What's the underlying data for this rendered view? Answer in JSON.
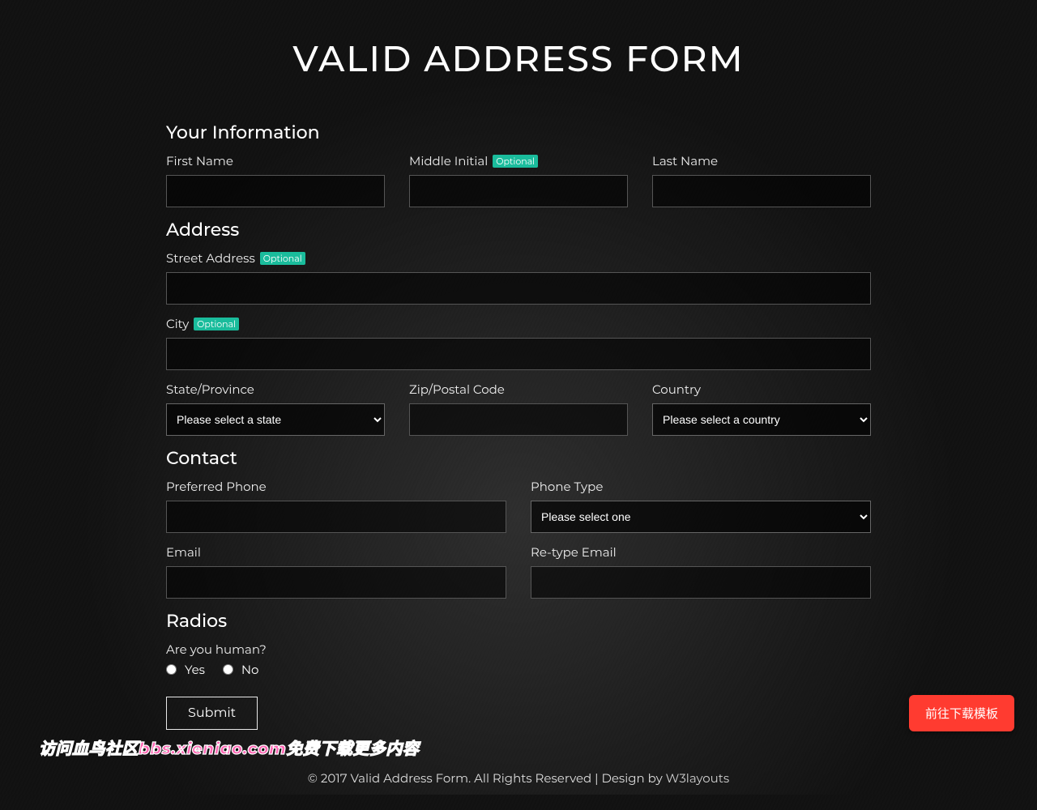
{
  "page": {
    "title": "VALID ADDRESS FORM"
  },
  "sections": {
    "info": {
      "heading": "Your Information",
      "first_name": {
        "label": "First Name",
        "value": ""
      },
      "middle_initial": {
        "label": "Middle Initial",
        "badge": "Optional",
        "value": ""
      },
      "last_name": {
        "label": "Last Name",
        "value": ""
      }
    },
    "address": {
      "heading": "Address",
      "street": {
        "label": "Street Address",
        "badge": "Optional",
        "value": ""
      },
      "city": {
        "label": "City",
        "badge": "Optional",
        "value": ""
      },
      "state": {
        "label": "State/Province",
        "selected": "Please select a state"
      },
      "zip": {
        "label": "Zip/Postal Code",
        "value": ""
      },
      "country": {
        "label": "Country",
        "selected": "Please select a country"
      }
    },
    "contact": {
      "heading": "Contact",
      "phone": {
        "label": "Preferred Phone",
        "value": ""
      },
      "phone_type": {
        "label": "Phone Type",
        "selected": "Please select one"
      },
      "email": {
        "label": "Email",
        "value": ""
      },
      "retype_email": {
        "label": "Re-type Email",
        "value": ""
      }
    },
    "radios": {
      "heading": "Radios",
      "question": "Are you human?",
      "options": {
        "yes": "Yes",
        "no": "No"
      },
      "selected": null
    }
  },
  "actions": {
    "submit": "Submit"
  },
  "footer": {
    "text": "© 2017 Valid Address Form. All Rights Reserved | Design by ",
    "link_text": "W3layouts"
  },
  "overlay": {
    "download_button": "前往下载模板",
    "community_banner": "访问血鸟社区bbs.xieniao.com免费下载更多内容"
  }
}
